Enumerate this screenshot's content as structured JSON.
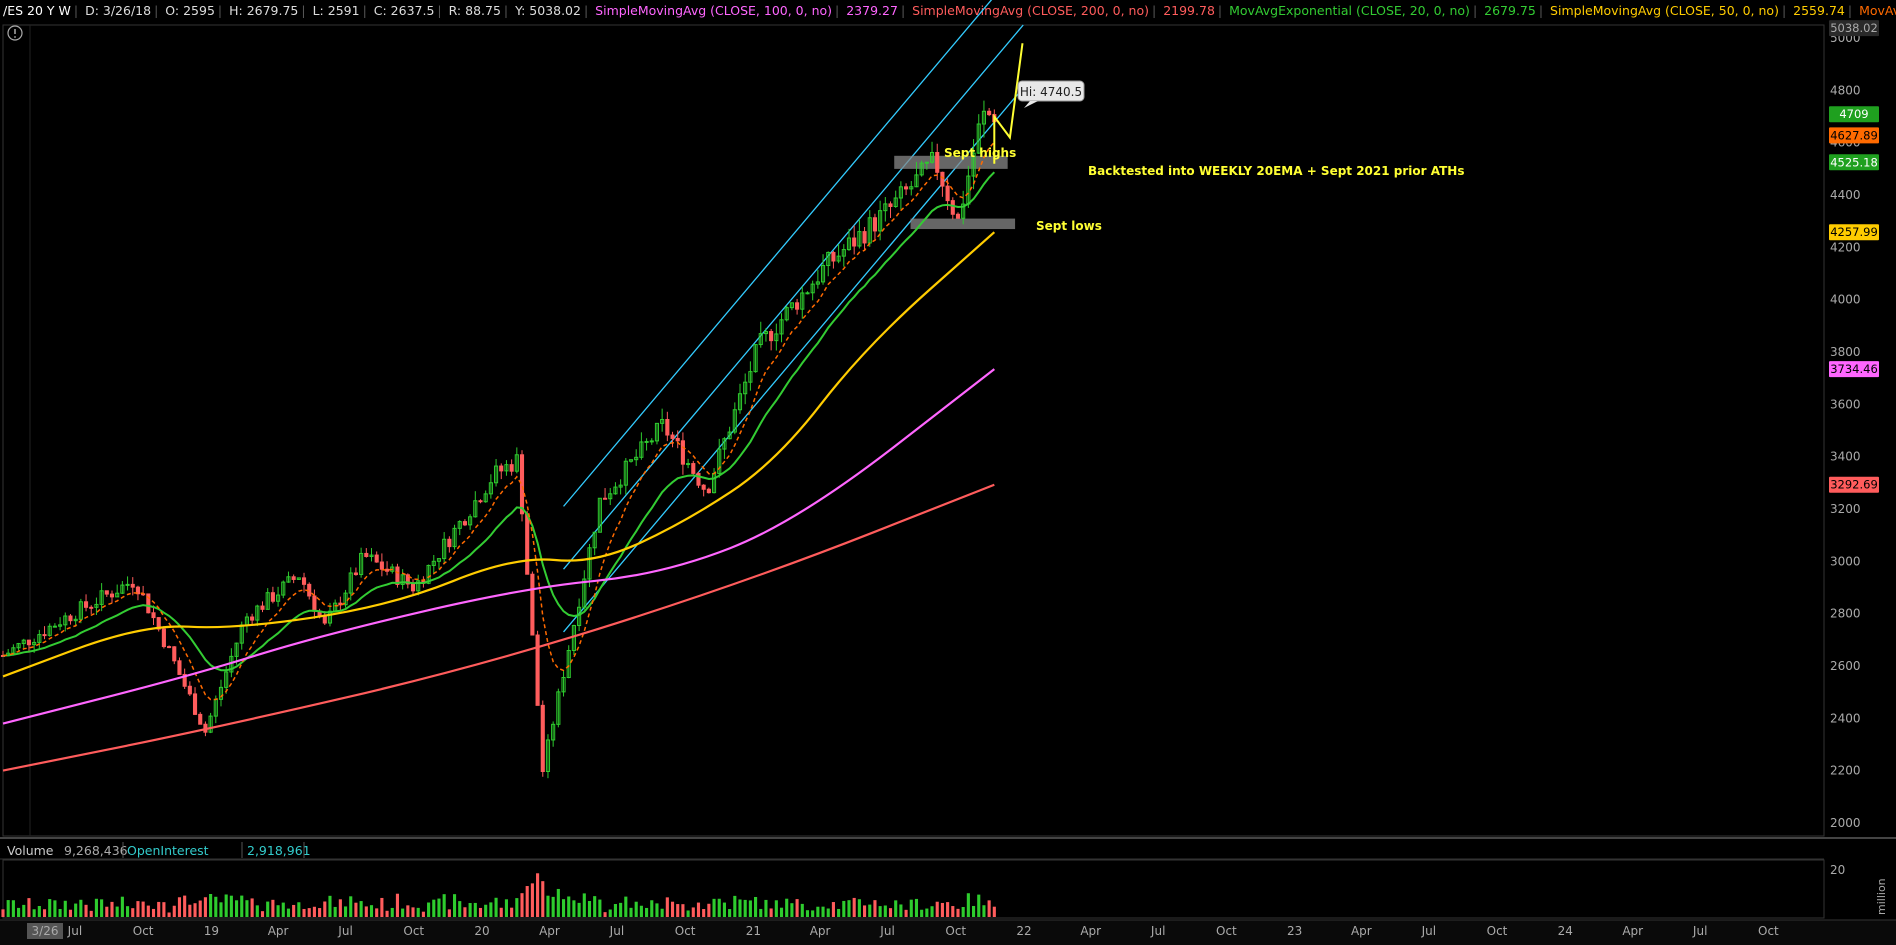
{
  "header": {
    "symbol": "/ES 20 Y W",
    "date": "D: 3/26/18",
    "open": "O: 2595",
    "high": "H: 2679.75",
    "low": "L: 2591",
    "close": "C: 2637.5",
    "range": "R: 88.75",
    "y": "Y: 5038.02",
    "studies": [
      {
        "label": "SimpleMovingAvg (CLOSE, 100, 0, no)",
        "value": "2379.27",
        "color": "#ff66ff"
      },
      {
        "label": "SimpleMovingAvg (CLOSE, 200, 0, no)",
        "value": "2199.78",
        "color": "#ff5c5c"
      },
      {
        "label": "MovAvgExponential (CLOSE, 20, 0, no)",
        "value": "2679.75",
        "color": "#33cc33"
      },
      {
        "label": "SimpleMovingAvg (CLOSE, 50, 0, no)",
        "value": "2559.74",
        "color": "#ffcc00"
      },
      {
        "label": "MovAvgExponential (CLOSE...",
        "value": "",
        "color": "#ff6a00"
      }
    ]
  },
  "price_badges": [
    {
      "text": "5038.02",
      "price": 5038.02,
      "bg": "#2a2a2a",
      "fg": "#aaaaaa"
    },
    {
      "text": "4709",
      "price": 4709,
      "bg": "#1fa01f",
      "fg": "#ffffff"
    },
    {
      "text": "4627.89",
      "price": 4627.89,
      "bg": "#ff6a00",
      "fg": "#000000"
    },
    {
      "text": "4525.18",
      "price": 4525.18,
      "bg": "#1fa01f",
      "fg": "#ffffff"
    },
    {
      "text": "4257.99",
      "price": 4257.99,
      "bg": "#ffcc00",
      "fg": "#000000"
    },
    {
      "text": "3734.46",
      "price": 3734.46,
      "bg": "#ff66ff",
      "fg": "#000000"
    },
    {
      "text": "3292.69",
      "price": 3292.69,
      "bg": "#ff5c5c",
      "fg": "#000000"
    }
  ],
  "annotations": {
    "hi_label": "Hi: 4740.5",
    "sept_highs": "Sept highs",
    "backtest": "Backtested into WEEKLY 20EMA + Sept 2021 prior ATHs",
    "sept_lows": "Sept lows"
  },
  "volume_panel": {
    "volume_label": "Volume",
    "volume_value": "9,268,436",
    "oi_label": "OpenInterest",
    "oi_value": "2,918,961",
    "unit_label": "million",
    "axis_tick": "20"
  },
  "chart_data": {
    "type": "candlestick",
    "title": "",
    "xlabel": "",
    "ylabel": "",
    "ylim": [
      1950,
      5050
    ],
    "y_ticks": [
      2000,
      2200,
      2400,
      2600,
      2800,
      3000,
      3200,
      3400,
      3600,
      3800,
      4000,
      4200,
      4400,
      4600,
      4800,
      5000
    ],
    "x_tick_labels": [
      "3/26",
      "Jul",
      "Oct",
      "19",
      "Apr",
      "Jul",
      "Oct",
      "20",
      "Apr",
      "Jul",
      "Oct",
      "21",
      "Apr",
      "Jul",
      "Oct",
      "22",
      "Apr",
      "Jul",
      "Oct",
      "23",
      "Apr",
      "Jul",
      "Oct",
      "24",
      "Apr",
      "Jul",
      "Oct"
    ],
    "x_start": "2018-03-26",
    "x_end": "2024-12-15",
    "last_bar": "2021-11-22",
    "close_anchors": [
      [
        "2018-03-26",
        2640
      ],
      [
        "2018-06-15",
        2780
      ],
      [
        "2018-09-20",
        2930
      ],
      [
        "2018-10-29",
        2700
      ],
      [
        "2018-12-24",
        2350
      ],
      [
        "2019-02-15",
        2780
      ],
      [
        "2019-04-30",
        2950
      ],
      [
        "2019-06-03",
        2750
      ],
      [
        "2019-07-26",
        3020
      ],
      [
        "2019-10-02",
        2900
      ],
      [
        "2020-01-17",
        3330
      ],
      [
        "2020-02-19",
        3390
      ],
      [
        "2020-03-23",
        2200
      ],
      [
        "2020-06-08",
        3230
      ],
      [
        "2020-09-01",
        3520
      ],
      [
        "2020-10-30",
        3270
      ],
      [
        "2021-01-08",
        3820
      ],
      [
        "2021-04-09",
        4130
      ],
      [
        "2021-07-09",
        4360
      ],
      [
        "2021-09-03",
        4530
      ],
      [
        "2021-10-04",
        4300
      ],
      [
        "2021-11-05",
        4700
      ],
      [
        "2021-11-22",
        4709
      ]
    ],
    "series": [
      {
        "name": "SimpleMovingAvg (CLOSE, 200, 0, no)",
        "color": "#ff5c5c",
        "points": [
          [
            "2018-03-26",
            2200
          ],
          [
            "2019-01-01",
            2360
          ],
          [
            "2020-01-01",
            2600
          ],
          [
            "2021-01-01",
            2930
          ],
          [
            "2021-11-22",
            3292.69
          ]
        ]
      },
      {
        "name": "SimpleMovingAvg (CLOSE, 100, 0, no)",
        "color": "#ff66ff",
        "points": [
          [
            "2018-03-26",
            2380
          ],
          [
            "2018-12-01",
            2560
          ],
          [
            "2019-06-01",
            2720
          ],
          [
            "2020-03-01",
            2900
          ],
          [
            "2020-09-01",
            2950
          ],
          [
            "2021-03-01",
            3150
          ],
          [
            "2021-11-22",
            3734.46
          ]
        ]
      },
      {
        "name": "SimpleMovingAvg (CLOSE, 50, 0, no)",
        "color": "#ffcc00",
        "points": [
          [
            "2018-03-26",
            2560
          ],
          [
            "2018-10-01",
            2760
          ],
          [
            "2019-02-01",
            2740
          ],
          [
            "2019-09-01",
            2830
          ],
          [
            "2020-02-15",
            3020
          ],
          [
            "2020-06-01",
            2990
          ],
          [
            "2020-10-01",
            3150
          ],
          [
            "2021-02-01",
            3380
          ],
          [
            "2021-06-01",
            3820
          ],
          [
            "2021-11-22",
            4257.99
          ]
        ]
      }
    ],
    "trend_channel": {
      "lower_start": [
        "2020-04-20",
        2730
      ],
      "lower_end": [
        "2021-12-31",
        4810
      ],
      "middle_offset": 240,
      "upper_offset": 480
    },
    "zones": [
      {
        "label": "Sept highs / backtest zone",
        "from": "2021-07-10",
        "to": "2021-12-10",
        "low": 4500,
        "high": 4550
      },
      {
        "label": "Sept lows",
        "from": "2021-08-01",
        "to": "2021-12-20",
        "low": 4270,
        "high": 4310
      }
    ],
    "projection": [
      [
        "2021-11-22",
        4520
      ],
      [
        "2021-11-22",
        4700
      ],
      [
        "2021-12-13",
        4620
      ],
      [
        "2021-12-30",
        4980
      ]
    ],
    "volume_ylim": [
      0,
      25
    ]
  }
}
